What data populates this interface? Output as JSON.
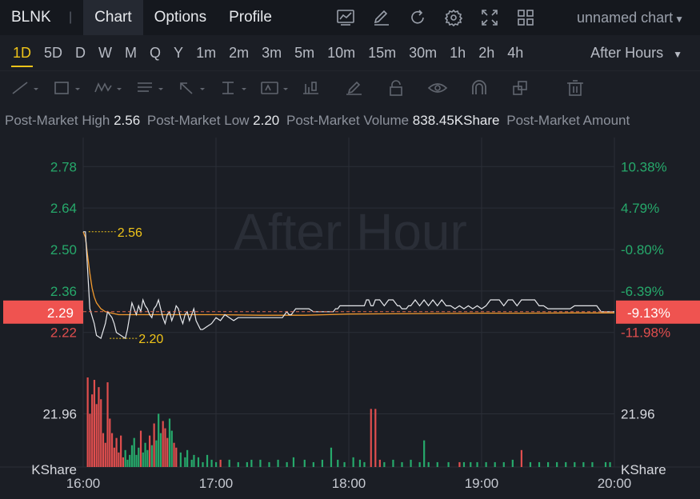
{
  "header": {
    "ticker": "BLNK",
    "separator": "|",
    "tabs": [
      {
        "label": "Chart",
        "active": true
      },
      {
        "label": "Options",
        "active": false
      },
      {
        "label": "Profile",
        "active": false
      }
    ],
    "toolbar_icons": [
      "indicator-icon",
      "draw-icon",
      "refresh-icon",
      "settings-icon",
      "fullscreen-icon",
      "layout-icon"
    ],
    "chart_name": "unnamed chart"
  },
  "intervals": {
    "items": [
      "1D",
      "5D",
      "D",
      "W",
      "M",
      "Q",
      "Y",
      "1m",
      "2m",
      "3m",
      "5m",
      "10m",
      "15m",
      "30m",
      "1h",
      "2h",
      "4h"
    ],
    "active": "1D",
    "session": "After Hours"
  },
  "drawing_tools": [
    "line-tool-icon",
    "rectangle-tool-icon",
    "pattern-tool-icon",
    "fib-tool-icon",
    "arrow-tool-icon",
    "measure-tool-icon",
    "text-tool-icon",
    "bar-pattern-icon",
    "brush-icon",
    "lock-icon",
    "eye-icon",
    "magnet-icon",
    "layers-icon",
    "trash-icon"
  ],
  "stats": [
    {
      "label": "Post-Market High",
      "value": "2.56"
    },
    {
      "label": "Post-Market Low",
      "value": "2.20"
    },
    {
      "label": "Post-Market Volume",
      "value": "838.45KShare"
    },
    {
      "label": "Post-Market Amount",
      "value": ""
    }
  ],
  "colors": {
    "up": "#26a96b",
    "down": "#e04e4e",
    "price_line": "#e6e8ec",
    "avg_line": "#f29a2e",
    "marker": "#f0c419"
  },
  "chart_data": {
    "type": "line",
    "watermark": "After Hour",
    "x_ticks": [
      "16:00",
      "17:00",
      "18:00",
      "19:00",
      "20:00"
    ],
    "x_range": [
      0,
      240
    ],
    "y_ticks": [
      2.78,
      2.64,
      2.5,
      2.36,
      2.22
    ],
    "y_ticks_text": [
      "2.78",
      "2.64",
      "2.50",
      "2.36",
      "2.22"
    ],
    "pct_ticks_text": [
      "10.38%",
      "4.79%",
      "-0.80%",
      "-6.39%",
      "-11.98%"
    ],
    "y_range": [
      2.176,
      2.878
    ],
    "current_price": "2.29",
    "current_pct": "-9.13%",
    "current_value": 2.29,
    "high_label": "2.56",
    "low_label": "2.20",
    "high_marker": {
      "x": 1,
      "y": 2.56
    },
    "low_marker": {
      "x": 12,
      "y": 2.2
    },
    "volume_label_left": "21.96",
    "volume_label_right": "21.96",
    "volume_unit": "KShare",
    "volume_mark_value": 21.96,
    "volume_max": 37,
    "price_series": {
      "name": "",
      "points": [
        [
          0,
          2.56
        ],
        [
          1,
          2.56
        ],
        [
          3,
          2.3
        ],
        [
          5,
          2.25
        ],
        [
          6,
          2.21
        ],
        [
          8,
          2.2
        ],
        [
          10,
          2.25
        ],
        [
          11,
          2.29
        ],
        [
          13,
          2.27
        ],
        [
          14,
          2.25
        ],
        [
          15,
          2.22
        ],
        [
          17,
          2.21
        ],
        [
          19,
          2.2
        ],
        [
          20,
          2.23
        ],
        [
          22,
          2.32
        ],
        [
          23,
          2.3
        ],
        [
          24,
          2.28
        ],
        [
          25,
          2.31
        ],
        [
          26,
          2.29
        ],
        [
          27,
          2.33
        ],
        [
          28,
          2.31
        ],
        [
          29,
          2.3
        ],
        [
          30,
          2.28
        ],
        [
          31,
          2.27
        ],
        [
          32,
          2.3
        ],
        [
          33,
          2.31
        ],
        [
          34,
          2.33
        ],
        [
          35,
          2.3
        ],
        [
          36,
          2.27
        ],
        [
          37,
          2.25
        ],
        [
          38,
          2.28
        ],
        [
          39,
          2.29
        ],
        [
          40,
          2.26
        ],
        [
          41,
          2.28
        ],
        [
          42,
          2.31
        ],
        [
          43,
          2.3
        ],
        [
          44,
          2.27
        ],
        [
          45,
          2.25
        ],
        [
          46,
          2.28
        ],
        [
          47,
          2.29
        ],
        [
          48,
          2.26
        ],
        [
          49,
          2.28
        ],
        [
          50,
          2.3
        ],
        [
          51,
          2.26
        ],
        [
          53,
          2.23
        ],
        [
          54,
          2.23
        ],
        [
          56,
          2.24
        ],
        [
          58,
          2.25
        ],
        [
          60,
          2.27
        ],
        [
          62,
          2.26
        ],
        [
          64,
          2.28
        ],
        [
          66,
          2.27
        ],
        [
          68,
          2.26
        ],
        [
          70,
          2.27
        ],
        [
          72,
          2.27
        ],
        [
          76,
          2.27
        ],
        [
          80,
          2.27
        ],
        [
          84,
          2.27
        ],
        [
          88,
          2.27
        ],
        [
          90,
          2.27
        ],
        [
          92,
          2.29
        ],
        [
          93,
          2.28
        ],
        [
          94,
          2.28
        ],
        [
          96,
          2.3
        ],
        [
          98,
          2.3
        ],
        [
          100,
          2.3
        ],
        [
          102,
          2.3
        ],
        [
          104,
          2.29
        ],
        [
          106,
          2.29
        ],
        [
          108,
          2.29
        ],
        [
          110,
          2.29
        ],
        [
          112,
          2.29
        ],
        [
          113,
          2.29
        ],
        [
          114,
          2.3
        ],
        [
          115,
          2.3
        ],
        [
          116,
          2.31
        ],
        [
          117,
          2.31
        ],
        [
          118,
          2.31
        ],
        [
          119,
          2.31
        ],
        [
          120,
          2.31
        ],
        [
          121,
          2.31
        ],
        [
          122,
          2.31
        ],
        [
          124,
          2.31
        ],
        [
          126,
          2.31
        ],
        [
          127,
          2.31
        ],
        [
          128,
          2.33
        ],
        [
          129,
          2.33
        ],
        [
          130,
          2.31
        ],
        [
          131,
          2.31
        ],
        [
          132,
          2.33
        ],
        [
          134,
          2.33
        ],
        [
          136,
          2.31
        ],
        [
          138,
          2.33
        ],
        [
          140,
          2.33
        ],
        [
          142,
          2.31
        ],
        [
          143,
          2.31
        ],
        [
          144,
          2.3
        ],
        [
          146,
          2.3
        ],
        [
          147,
          2.31
        ],
        [
          148,
          2.31
        ],
        [
          150,
          2.33
        ],
        [
          152,
          2.31
        ],
        [
          154,
          2.33
        ],
        [
          156,
          2.31
        ],
        [
          158,
          2.33
        ],
        [
          160,
          2.31
        ],
        [
          162,
          2.33
        ],
        [
          164,
          2.31
        ],
        [
          166,
          2.31
        ],
        [
          168,
          2.3
        ],
        [
          170,
          2.31
        ],
        [
          172,
          2.3
        ],
        [
          174,
          2.31
        ],
        [
          176,
          2.3
        ],
        [
          178,
          2.31
        ],
        [
          180,
          2.3
        ],
        [
          182,
          2.31
        ],
        [
          184,
          2.33
        ],
        [
          186,
          2.33
        ],
        [
          188,
          2.33
        ],
        [
          190,
          2.31
        ],
        [
          192,
          2.33
        ],
        [
          194,
          2.33
        ],
        [
          196,
          2.31
        ],
        [
          198,
          2.33
        ],
        [
          200,
          2.33
        ],
        [
          202,
          2.33
        ],
        [
          204,
          2.33
        ],
        [
          206,
          2.31
        ],
        [
          208,
          2.31
        ],
        [
          210,
          2.3
        ],
        [
          212,
          2.3
        ],
        [
          214,
          2.3
        ],
        [
          216,
          2.3
        ],
        [
          218,
          2.3
        ],
        [
          220,
          2.3
        ],
        [
          222,
          2.31
        ],
        [
          224,
          2.31
        ],
        [
          226,
          2.31
        ],
        [
          228,
          2.31
        ],
        [
          230,
          2.31
        ],
        [
          232,
          2.31
        ],
        [
          234,
          2.29
        ],
        [
          236,
          2.29
        ],
        [
          238,
          2.29
        ],
        [
          240,
          2.29
        ]
      ]
    },
    "avg_series": {
      "name": "",
      "points": [
        [
          0,
          2.56
        ],
        [
          1,
          2.54
        ],
        [
          2,
          2.48
        ],
        [
          3,
          2.42
        ],
        [
          4,
          2.37
        ],
        [
          5,
          2.34
        ],
        [
          6,
          2.32
        ],
        [
          8,
          2.3
        ],
        [
          10,
          2.29
        ],
        [
          13,
          2.285
        ],
        [
          16,
          2.28
        ],
        [
          20,
          2.28
        ],
        [
          30,
          2.28
        ],
        [
          40,
          2.28
        ],
        [
          60,
          2.28
        ],
        [
          80,
          2.278
        ],
        [
          100,
          2.278
        ],
        [
          110,
          2.28
        ],
        [
          120,
          2.282
        ],
        [
          140,
          2.283
        ],
        [
          160,
          2.284
        ],
        [
          180,
          2.285
        ],
        [
          200,
          2.285
        ],
        [
          220,
          2.286
        ],
        [
          240,
          2.286
        ]
      ]
    },
    "volume": [
      {
        "x": 2,
        "v": 37,
        "dir": "down"
      },
      {
        "x": 3,
        "v": 22,
        "dir": "down"
      },
      {
        "x": 4,
        "v": 30,
        "dir": "down"
      },
      {
        "x": 5,
        "v": 36,
        "dir": "down"
      },
      {
        "x": 6,
        "v": 26,
        "dir": "down"
      },
      {
        "x": 7,
        "v": 33,
        "dir": "down"
      },
      {
        "x": 8,
        "v": 28,
        "dir": "down"
      },
      {
        "x": 9,
        "v": 14,
        "dir": "down"
      },
      {
        "x": 10,
        "v": 10,
        "dir": "down"
      },
      {
        "x": 11,
        "v": 35,
        "dir": "down"
      },
      {
        "x": 12,
        "v": 20,
        "dir": "down"
      },
      {
        "x": 13,
        "v": 14,
        "dir": "down"
      },
      {
        "x": 14,
        "v": 8,
        "dir": "down"
      },
      {
        "x": 15,
        "v": 12,
        "dir": "down"
      },
      {
        "x": 16,
        "v": 6,
        "dir": "down"
      },
      {
        "x": 17,
        "v": 13,
        "dir": "down"
      },
      {
        "x": 18,
        "v": 4,
        "dir": "down"
      },
      {
        "x": 19,
        "v": 7,
        "dir": "up"
      },
      {
        "x": 20,
        "v": 3,
        "dir": "up"
      },
      {
        "x": 21,
        "v": 5,
        "dir": "up"
      },
      {
        "x": 22,
        "v": 9,
        "dir": "up"
      },
      {
        "x": 23,
        "v": 12,
        "dir": "up"
      },
      {
        "x": 24,
        "v": 5,
        "dir": "up"
      },
      {
        "x": 25,
        "v": 8,
        "dir": "up"
      },
      {
        "x": 26,
        "v": 15,
        "dir": "down"
      },
      {
        "x": 27,
        "v": 6,
        "dir": "up"
      },
      {
        "x": 28,
        "v": 10,
        "dir": "up"
      },
      {
        "x": 29,
        "v": 7,
        "dir": "up"
      },
      {
        "x": 30,
        "v": 13,
        "dir": "down"
      },
      {
        "x": 31,
        "v": 9,
        "dir": "up"
      },
      {
        "x": 32,
        "v": 18,
        "dir": "down"
      },
      {
        "x": 33,
        "v": 11,
        "dir": "up"
      },
      {
        "x": 34,
        "v": 22,
        "dir": "up"
      },
      {
        "x": 35,
        "v": 14,
        "dir": "up"
      },
      {
        "x": 36,
        "v": 19,
        "dir": "down"
      },
      {
        "x": 37,
        "v": 16,
        "dir": "down"
      },
      {
        "x": 38,
        "v": 12,
        "dir": "down"
      },
      {
        "x": 39,
        "v": 20,
        "dir": "up"
      },
      {
        "x": 40,
        "v": 15,
        "dir": "up"
      },
      {
        "x": 41,
        "v": 10,
        "dir": "down"
      },
      {
        "x": 42,
        "v": 8,
        "dir": "down"
      },
      {
        "x": 44,
        "v": 6,
        "dir": "up"
      },
      {
        "x": 46,
        "v": 4,
        "dir": "up"
      },
      {
        "x": 47,
        "v": 7,
        "dir": "up"
      },
      {
        "x": 49,
        "v": 3,
        "dir": "up"
      },
      {
        "x": 50,
        "v": 5,
        "dir": "up"
      },
      {
        "x": 52,
        "v": 4,
        "dir": "up"
      },
      {
        "x": 54,
        "v": 2,
        "dir": "up"
      },
      {
        "x": 56,
        "v": 5,
        "dir": "up"
      },
      {
        "x": 58,
        "v": 3,
        "dir": "up"
      },
      {
        "x": 60,
        "v": 2,
        "dir": "up"
      },
      {
        "x": 62,
        "v": 3,
        "dir": "down"
      },
      {
        "x": 66,
        "v": 3,
        "dir": "up"
      },
      {
        "x": 70,
        "v": 2,
        "dir": "up"
      },
      {
        "x": 74,
        "v": 2,
        "dir": "up"
      },
      {
        "x": 76,
        "v": 3,
        "dir": "up"
      },
      {
        "x": 80,
        "v": 3,
        "dir": "up"
      },
      {
        "x": 84,
        "v": 2,
        "dir": "up"
      },
      {
        "x": 88,
        "v": 3,
        "dir": "up"
      },
      {
        "x": 92,
        "v": 2,
        "dir": "up"
      },
      {
        "x": 95,
        "v": 4,
        "dir": "up"
      },
      {
        "x": 100,
        "v": 3,
        "dir": "up"
      },
      {
        "x": 104,
        "v": 2,
        "dir": "up"
      },
      {
        "x": 108,
        "v": 3,
        "dir": "up"
      },
      {
        "x": 112,
        "v": 8,
        "dir": "up"
      },
      {
        "x": 115,
        "v": 3,
        "dir": "up"
      },
      {
        "x": 118,
        "v": 2,
        "dir": "up"
      },
      {
        "x": 122,
        "v": 4,
        "dir": "up"
      },
      {
        "x": 125,
        "v": 3,
        "dir": "up"
      },
      {
        "x": 127,
        "v": 2,
        "dir": "up"
      },
      {
        "x": 130,
        "v": 24,
        "dir": "down"
      },
      {
        "x": 132,
        "v": 24,
        "dir": "down"
      },
      {
        "x": 134,
        "v": 3,
        "dir": "down"
      },
      {
        "x": 136,
        "v": 2,
        "dir": "up"
      },
      {
        "x": 140,
        "v": 3,
        "dir": "up"
      },
      {
        "x": 144,
        "v": 2,
        "dir": "up"
      },
      {
        "x": 148,
        "v": 3,
        "dir": "up"
      },
      {
        "x": 152,
        "v": 2,
        "dir": "up"
      },
      {
        "x": 154,
        "v": 11,
        "dir": "up"
      },
      {
        "x": 156,
        "v": 2,
        "dir": "up"
      },
      {
        "x": 160,
        "v": 2,
        "dir": "up"
      },
      {
        "x": 165,
        "v": 2,
        "dir": "up"
      },
      {
        "x": 170,
        "v": 2,
        "dir": "down"
      },
      {
        "x": 172,
        "v": 2,
        "dir": "up"
      },
      {
        "x": 175,
        "v": 2,
        "dir": "up"
      },
      {
        "x": 178,
        "v": 2,
        "dir": "up"
      },
      {
        "x": 182,
        "v": 2,
        "dir": "up"
      },
      {
        "x": 186,
        "v": 2,
        "dir": "up"
      },
      {
        "x": 190,
        "v": 2,
        "dir": "up"
      },
      {
        "x": 194,
        "v": 3,
        "dir": "up"
      },
      {
        "x": 198,
        "v": 7,
        "dir": "down"
      },
      {
        "x": 202,
        "v": 2,
        "dir": "up"
      },
      {
        "x": 206,
        "v": 2,
        "dir": "up"
      },
      {
        "x": 210,
        "v": 2,
        "dir": "up"
      },
      {
        "x": 214,
        "v": 2,
        "dir": "up"
      },
      {
        "x": 218,
        "v": 2,
        "dir": "up"
      },
      {
        "x": 222,
        "v": 2,
        "dir": "up"
      },
      {
        "x": 226,
        "v": 2,
        "dir": "up"
      },
      {
        "x": 230,
        "v": 2,
        "dir": "up"
      },
      {
        "x": 236,
        "v": 2,
        "dir": "up"
      },
      {
        "x": 238,
        "v": 2,
        "dir": "up"
      }
    ]
  }
}
